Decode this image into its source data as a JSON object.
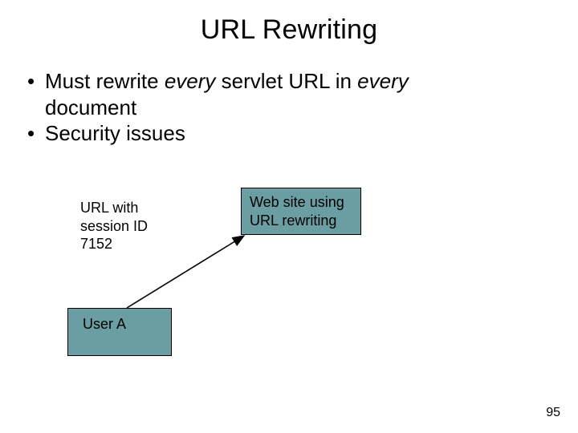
{
  "title": "URL Rewriting",
  "bullets": {
    "item1_pre": "Must rewrite ",
    "item1_em1": "every",
    "item1_mid": " servlet URL in ",
    "item1_em2": "every",
    "item1_line2": "document",
    "item2": "Security issues"
  },
  "label": {
    "line1": "URL with",
    "line2": "session ID",
    "line3": "7152"
  },
  "box_web": {
    "line1": "Web site using",
    "line2": "URL rewriting"
  },
  "box_user": "User A",
  "page_number": "95"
}
